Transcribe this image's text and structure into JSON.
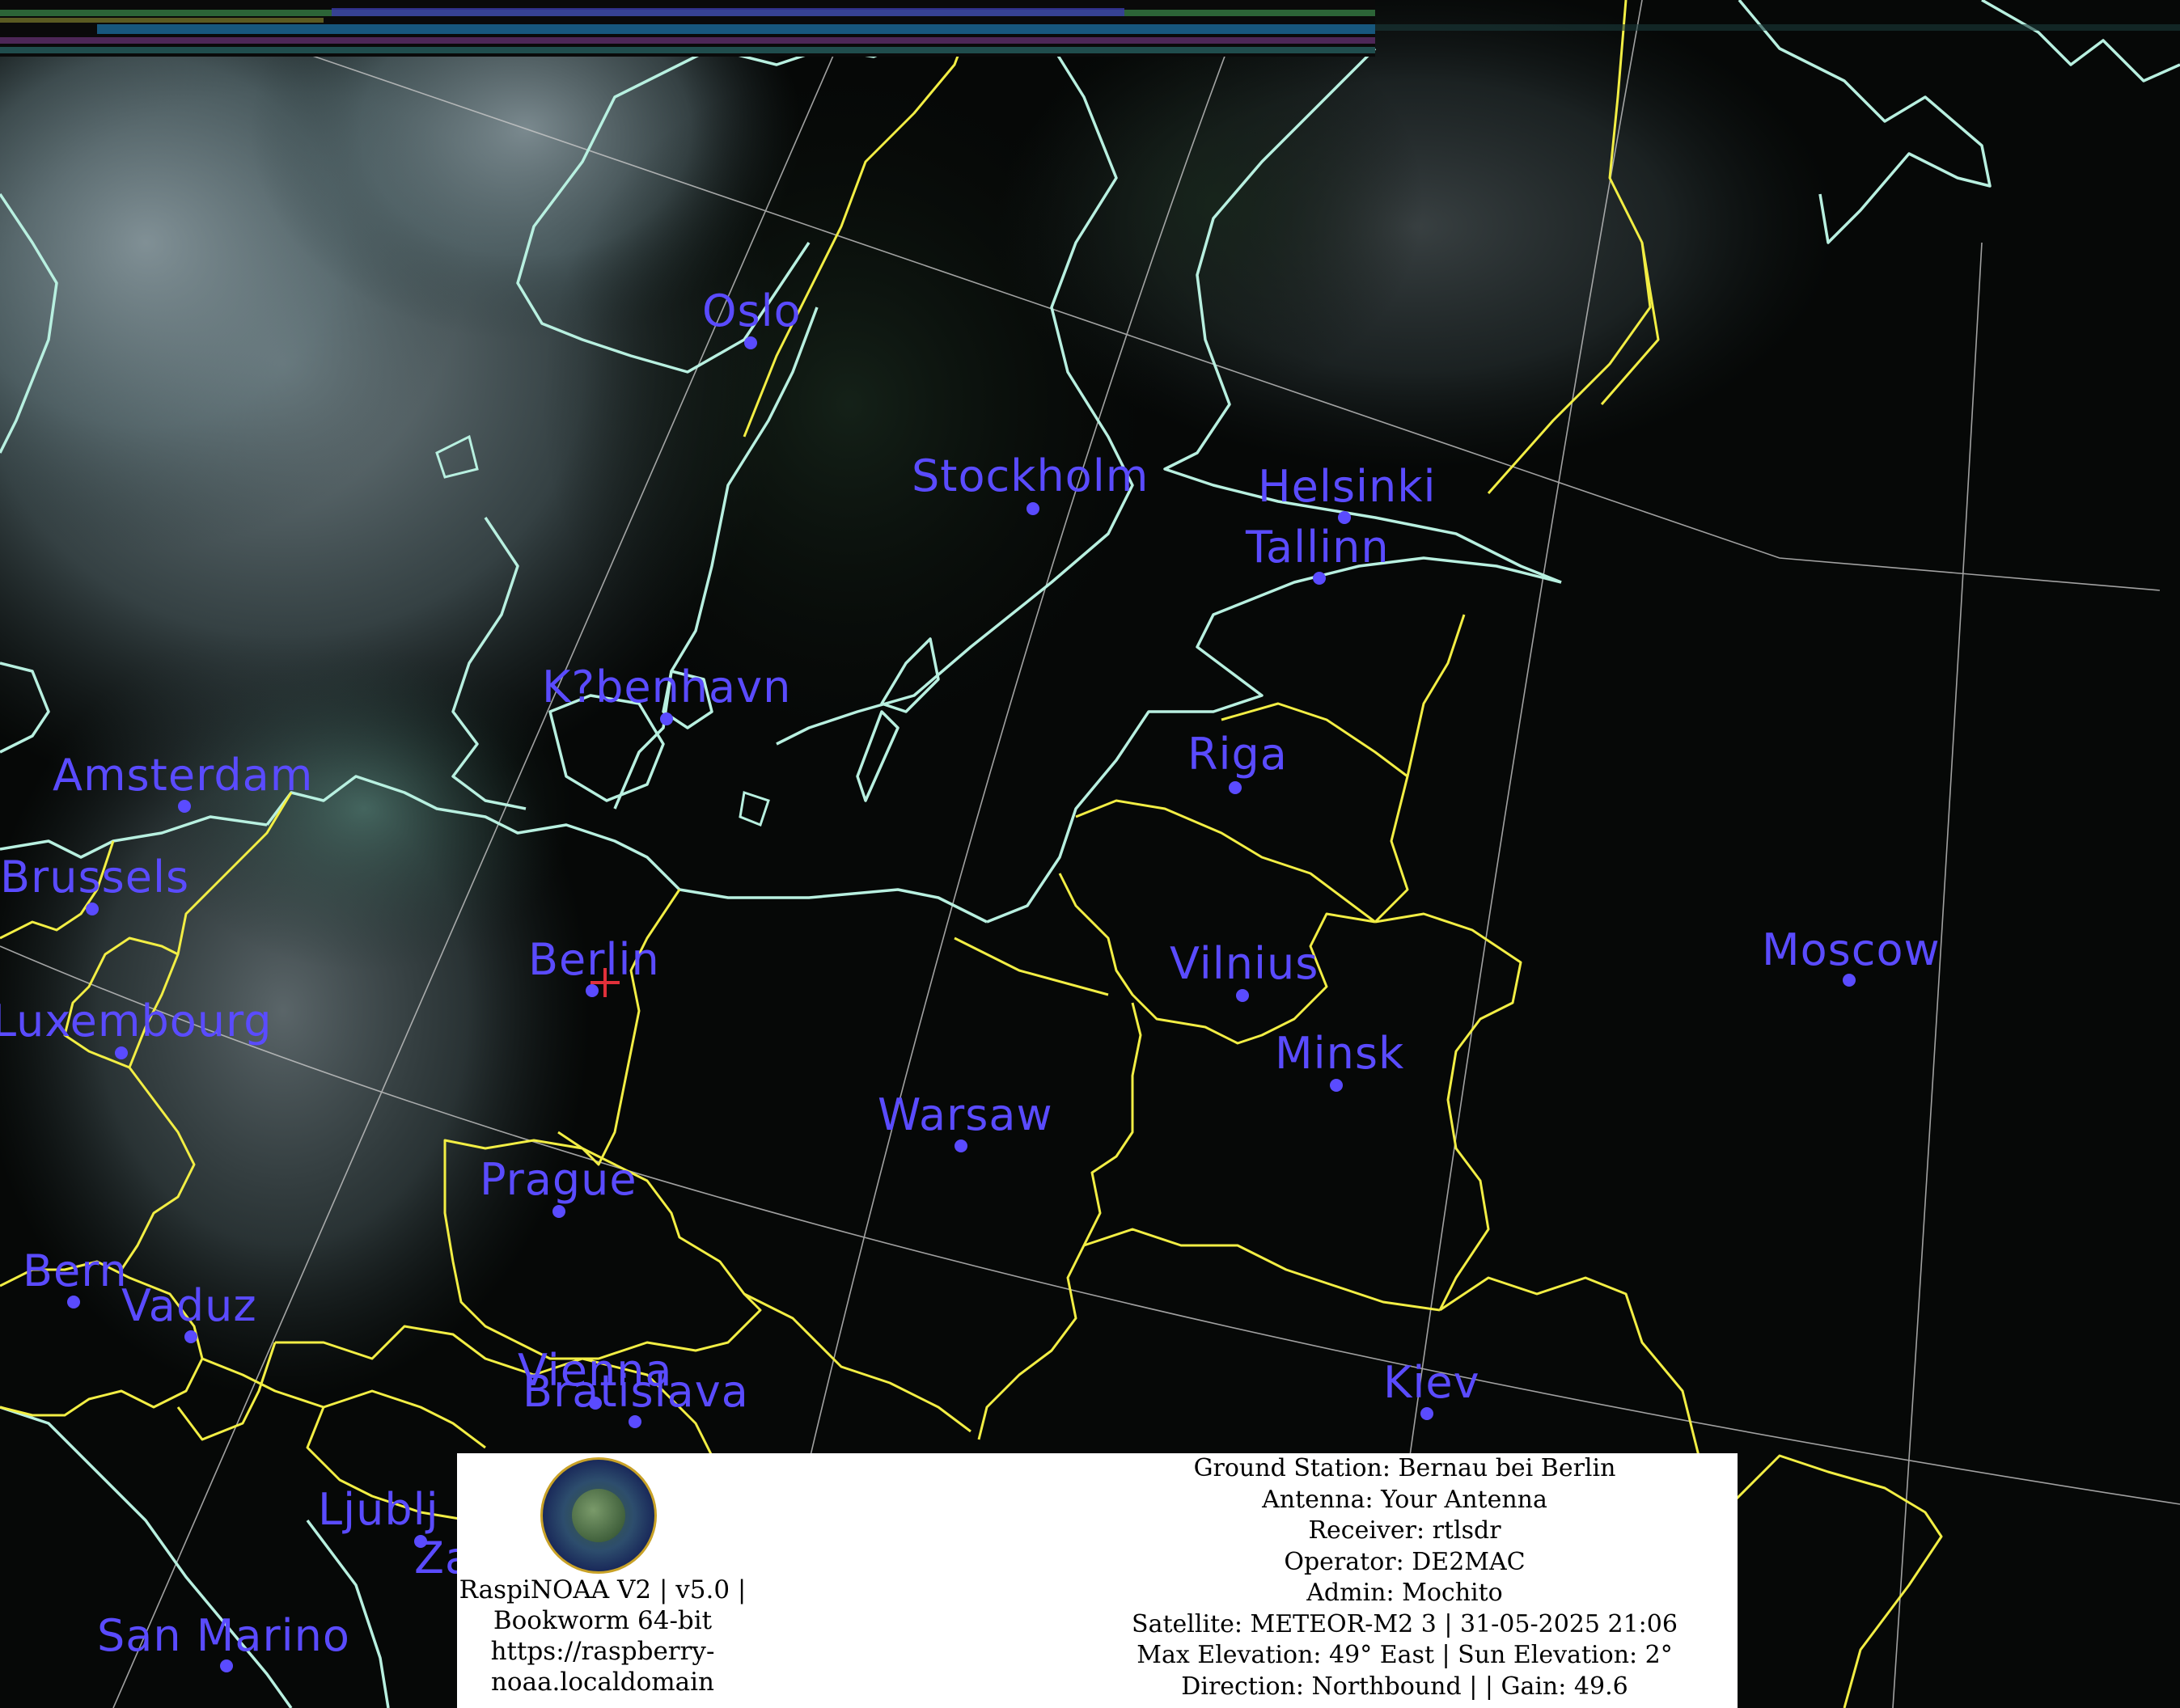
{
  "colors": {
    "city_label": "#5a4bff",
    "coastline": "#b8f0e0",
    "border": "#f2ee44",
    "grid": "#c8c8c8",
    "station_marker": "#e0303a"
  },
  "cities": [
    {
      "id": "oslo",
      "name": "Oslo"
    },
    {
      "id": "stockholm",
      "name": "Stockholm"
    },
    {
      "id": "helsinki",
      "name": "Helsinki"
    },
    {
      "id": "tallinn",
      "name": "Tallinn"
    },
    {
      "id": "kobenhavn",
      "name": "K?benhavn"
    },
    {
      "id": "riga",
      "name": "Riga"
    },
    {
      "id": "amsterdam",
      "name": "Amsterdam"
    },
    {
      "id": "brussels",
      "name": "Brussels"
    },
    {
      "id": "berlin",
      "name": "Berlin"
    },
    {
      "id": "vilnius",
      "name": "Vilnius"
    },
    {
      "id": "moscow",
      "name": "Moscow"
    },
    {
      "id": "luxembourg",
      "name": "Luxembourg"
    },
    {
      "id": "minsk",
      "name": "Minsk"
    },
    {
      "id": "warsaw",
      "name": "Warsaw"
    },
    {
      "id": "prague",
      "name": "Prague"
    },
    {
      "id": "bern",
      "name": "Bern"
    },
    {
      "id": "vaduz",
      "name": "Vaduz"
    },
    {
      "id": "vienna",
      "name": "Vienna"
    },
    {
      "id": "bratislava",
      "name": "Bratislava"
    },
    {
      "id": "kiev",
      "name": "Kiev"
    },
    {
      "id": "ljubljana",
      "name": "Ljublj"
    },
    {
      "id": "zagreb",
      "name": "Za"
    },
    {
      "id": "san-marino",
      "name": "San Marino"
    }
  ],
  "info_panel": {
    "brand": {
      "line1": "RaspiNOAA V2 | v5.0 |",
      "line2": "Bookworm 64-bit",
      "line3": "https://raspberry-",
      "line4": "noaa.localdomain"
    },
    "station": {
      "ground_station": "Ground Station: Bernau bei Berlin",
      "antenna": "Antenna: Your Antenna",
      "receiver": "Receiver: rtlsdr",
      "operator": "Operator: DE2MAC",
      "admin": "Admin: Mochito",
      "satellite": "Satellite: METEOR-M2 3 | 31-05-2025 21:06",
      "elevation": "Max Elevation: 49° East | Sun Elevation: 2°",
      "direction": "Direction: Northbound | | Gain: 49.6"
    }
  }
}
